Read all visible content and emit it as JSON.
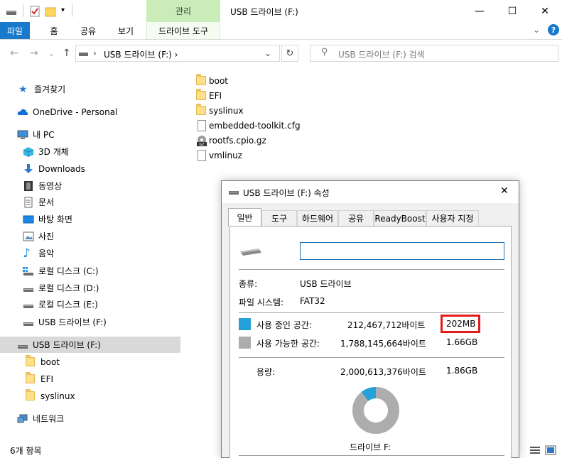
{
  "window": {
    "title": "USB 드라이브 (F:)",
    "context_tab": "관리",
    "minimize": "—",
    "maximize": "☐",
    "close": "✕"
  },
  "ribbon": {
    "tabs": [
      "파일",
      "홈",
      "공유",
      "보기",
      "드라이브 도구"
    ],
    "expand": "⌄",
    "help": "?"
  },
  "nav": {
    "back": "←",
    "forward": "→",
    "recent": "⌄",
    "up": "↑",
    "address": "USB 드라이브 (F:)  ›",
    "address_prefix": "›",
    "address_dropdown": "⌄",
    "refresh": "↻",
    "search_placeholder": "USB 드라이브 (F:) 검색",
    "search_icon": "⚲"
  },
  "sidebar": {
    "quick_access": "즐겨찾기",
    "onedrive": "OneDrive - Personal",
    "this_pc": "내 PC",
    "pc_items": [
      "3D 개체",
      "Downloads",
      "동영상",
      "문서",
      "바탕 화면",
      "사진",
      "음악",
      "로컬 디스크 (C:)",
      "로컬 디스크 (D:)",
      "로컬 디스크 (E:)",
      "USB 드라이브 (F:)"
    ],
    "selected_drive": "USB 드라이브 (F:)",
    "drive_children": [
      "boot",
      "EFI",
      "syslinux"
    ],
    "network": "네트워크"
  },
  "files": [
    {
      "name": "boot",
      "kind": "folder"
    },
    {
      "name": "EFI",
      "kind": "folder"
    },
    {
      "name": "syslinux",
      "kind": "folder"
    },
    {
      "name": "embedded-toolkit.cfg",
      "kind": "file"
    },
    {
      "name": "rootfs.cpio.gz",
      "kind": "archive"
    },
    {
      "name": "vmlinuz",
      "kind": "file"
    }
  ],
  "status": {
    "item_count": "6개 항목"
  },
  "dialog": {
    "title": "USB 드라이브 (F:) 속성",
    "close": "✕",
    "tabs": [
      "일반",
      "도구",
      "하드웨어",
      "공유",
      "ReadyBoost",
      "사용자 지정"
    ],
    "name_value": "",
    "type_label": "종류:",
    "type_value": "USB 드라이브",
    "fs_label": "파일 시스템:",
    "fs_value": "FAT32",
    "used_label": "사용 중인 공간:",
    "used_bytes": "212,467,712바이트",
    "used_size": "202MB",
    "free_label": "사용 가능한 공간:",
    "free_bytes": "1,788,145,664바이트",
    "free_size": "1.66GB",
    "capacity_label": "용량:",
    "capacity_bytes": "2,000,613,376바이트",
    "capacity_size": "1.86GB",
    "drive_caption": "드라이브 F:",
    "used_fraction": 0.106,
    "colors": {
      "used": "#26a0da",
      "free": "#adadad",
      "highlight": "#e41b1b"
    }
  }
}
